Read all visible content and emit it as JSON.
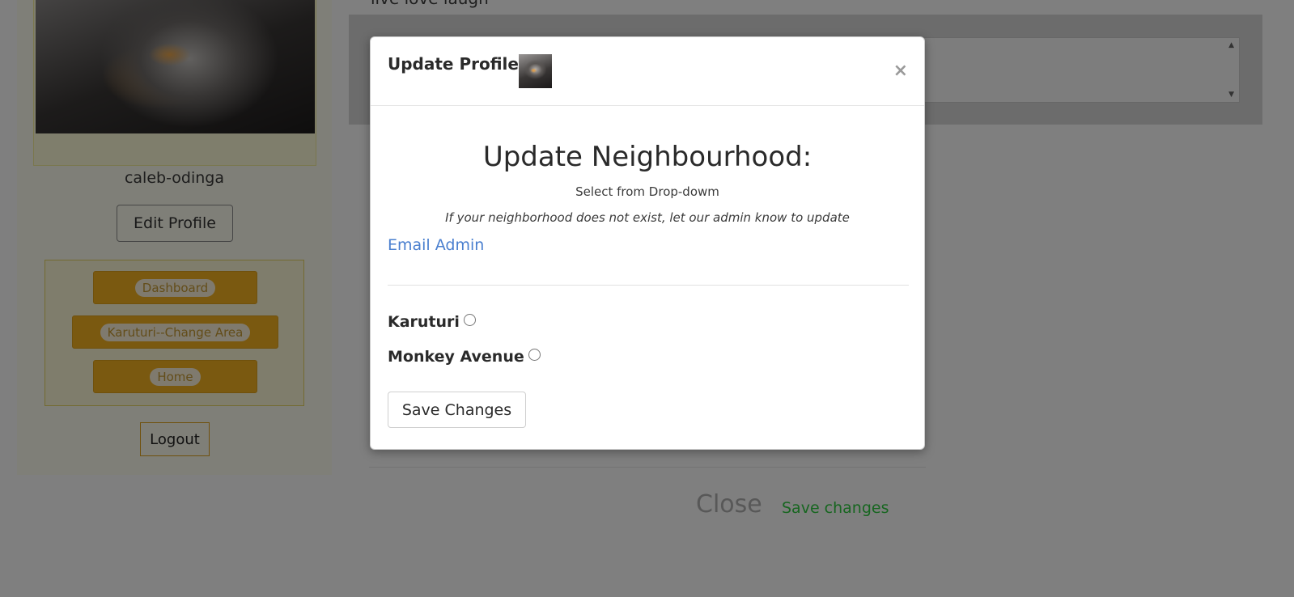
{
  "profile": {
    "username": "caleb-odinga",
    "edit_label": "Edit Profile",
    "bio_text": "live love laugh"
  },
  "nav": {
    "items": [
      {
        "label": "Dashboard"
      },
      {
        "label": "Karuturi--Change Area"
      },
      {
        "label": "Home"
      }
    ],
    "logout_label": "Logout"
  },
  "footer": {
    "close_label": "Close",
    "save_label": "Save changes"
  },
  "modal": {
    "title": "Update Profile",
    "close_glyph": "×",
    "heading": "Update Neighbourhood:",
    "select_hint": "Select from Drop-dowm",
    "note": "If your neighborhood does not exist, let our admin know to update",
    "email_admin_label": "Email Admin",
    "options": [
      {
        "label": "Karuturi",
        "checked": false
      },
      {
        "label": "Monkey Avenue",
        "checked": false
      }
    ],
    "save_label": "Save Changes"
  },
  "colors": {
    "accent_nav": "#f5b320",
    "link_blue": "#4a7fcf",
    "save_green": "#2ecc40"
  }
}
